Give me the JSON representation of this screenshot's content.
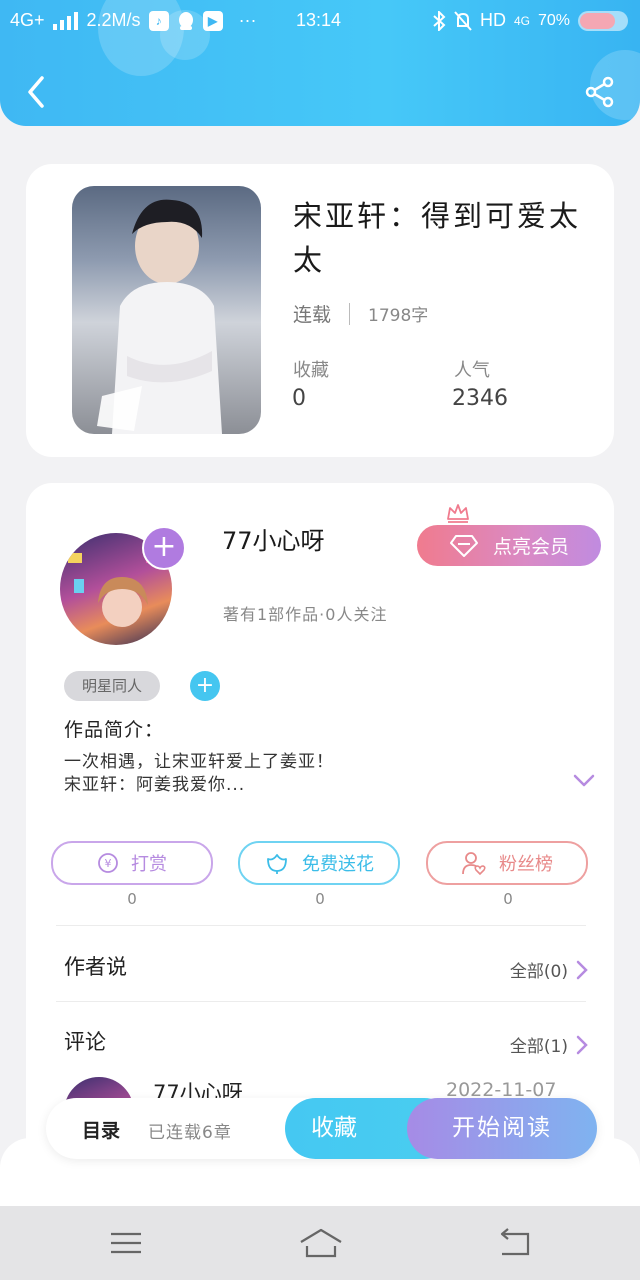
{
  "status_bar": {
    "network": "4G+",
    "speed": "2.2M/s",
    "dots": "···",
    "time": "13:14",
    "hd": "HD",
    "network_right": "4G",
    "battery": "70%"
  },
  "book": {
    "title": "宋亚轩：得到可爱太太",
    "status": "连载",
    "word_count": "1798字",
    "favorites_label": "收藏",
    "favorites_value": "0",
    "popularity_label": "人气",
    "popularity_value": "2346"
  },
  "author": {
    "name": "77小心呀",
    "stats": "著有1部作品·0人关注",
    "vip_label": "点亮会员",
    "tag": "明星同人"
  },
  "intro": {
    "label": "作品简介：",
    "text": "一次相遇，让宋亚轩爱上了姜亚！\n宋亚轩：阿姜我爱你..."
  },
  "actions": [
    {
      "label": "打赏",
      "count": "0",
      "color": "#b68be0"
    },
    {
      "label": "免费送花",
      "count": "0",
      "color": "#45c6f0"
    },
    {
      "label": "粉丝榜",
      "count": "0",
      "color": "#e88a8a"
    }
  ],
  "sections": {
    "author_says": {
      "title": "作者说",
      "link": "全部(0)"
    },
    "comments": {
      "title": "评论",
      "link": "全部(1)"
    }
  },
  "comment_preview": {
    "name": "77小心呀",
    "date": "2022-11-07"
  },
  "bottom_bar": {
    "toc": "目录",
    "toc_sub": "已连载6章",
    "collect": "收藏",
    "read": "开始阅读"
  },
  "colors": {
    "header": "#3fb8f3",
    "accent_blue": "#45c8f2",
    "accent_purple": "#b07be0",
    "vip_pink": "#f07b8e"
  }
}
